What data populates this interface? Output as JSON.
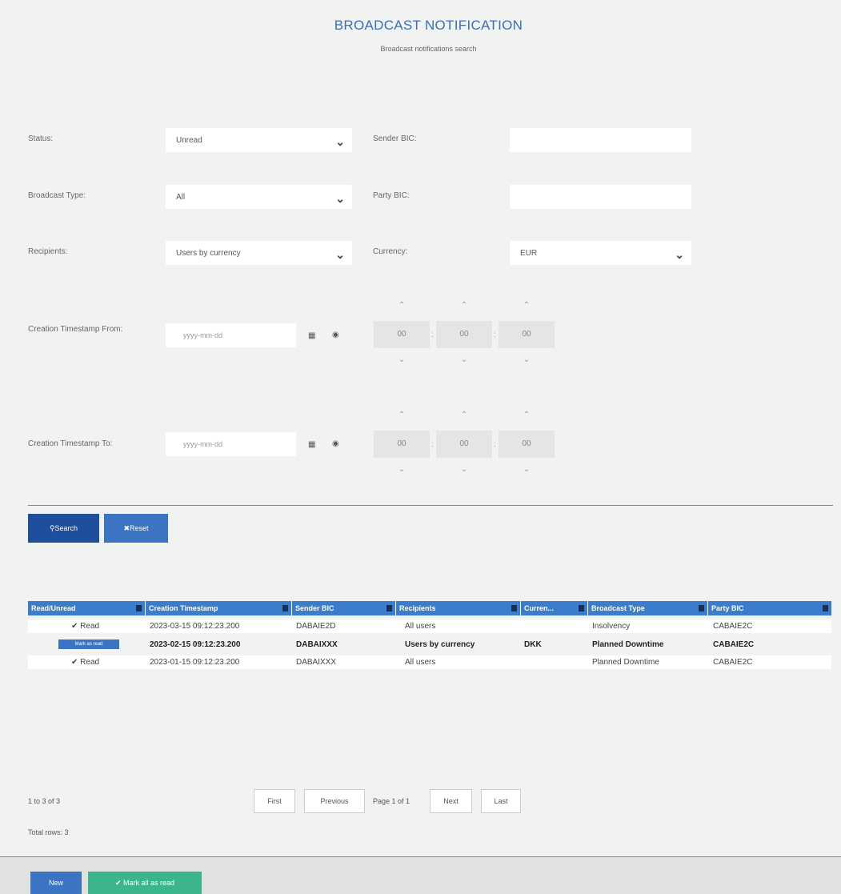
{
  "header": {
    "title": "BROADCAST NOTIFICATION",
    "subtitle": "Broadcast notifications search"
  },
  "form": {
    "status_label": "Status:",
    "status_value": "Unread",
    "sender_bic_label": "Sender BIC:",
    "sender_bic_value": "",
    "broadcast_type_label": "Broadcast Type:",
    "broadcast_type_value": "All",
    "party_bic_label": "Party BIC:",
    "party_bic_value": "",
    "recipients_label": "Recipients:",
    "recipients_value": "Users by currency",
    "currency_label": "Currency:",
    "currency_value": "EUR",
    "from_label": "Creation Timestamp From:",
    "to_label": "Creation Timestamp To:",
    "date_placeholder": "yyyy-mm-dd",
    "time_hours": "00",
    "time_minutes": "00",
    "time_seconds": "00",
    "time_separator": ":"
  },
  "actions": {
    "search_label": "Search",
    "reset_label": "Reset"
  },
  "grid": {
    "columns": [
      "Read/Unread",
      "Creation Timestamp",
      "Sender BIC",
      "Recipients",
      "Curren...",
      "Broadcast Type",
      "Party BIC"
    ],
    "rows": [
      {
        "read": "Read",
        "timestamp": "2023-03-15 09:12:23.200",
        "sender": "DABAIE2D",
        "recipients": "All users",
        "currency": "",
        "type": "Insolvency",
        "party": "CABAIE2C"
      },
      {
        "read": "Mark as read",
        "timestamp": "2023-02-15 09:12:23.200",
        "sender": "DABAIXXX",
        "recipients": "Users by currency",
        "currency": "DKK",
        "type": "Planned Downtime",
        "party": "CABAIE2C"
      },
      {
        "read": "Read",
        "timestamp": "2023-01-15 09:12:23.200",
        "sender": "DABAIXXX",
        "recipients": "All users",
        "currency": "",
        "type": "Planned Downtime",
        "party": "CABAIE2C"
      }
    ]
  },
  "pagination": {
    "range": "1 to 3 of 3",
    "first": "First",
    "previous": "Previous",
    "page_info": "Page 1 of 1",
    "next": "Next",
    "last": "Last",
    "total_rows": "Total rows: 3"
  },
  "footer": {
    "new_label": "New",
    "mark_all_label": "Mark all as read"
  },
  "colors": {
    "title": "#3a6fb5",
    "grid_header": "#3b7dcd",
    "primary_button": "#1e4f9c",
    "secondary_button": "#3a74c2",
    "success_button": "#3bb58a"
  }
}
